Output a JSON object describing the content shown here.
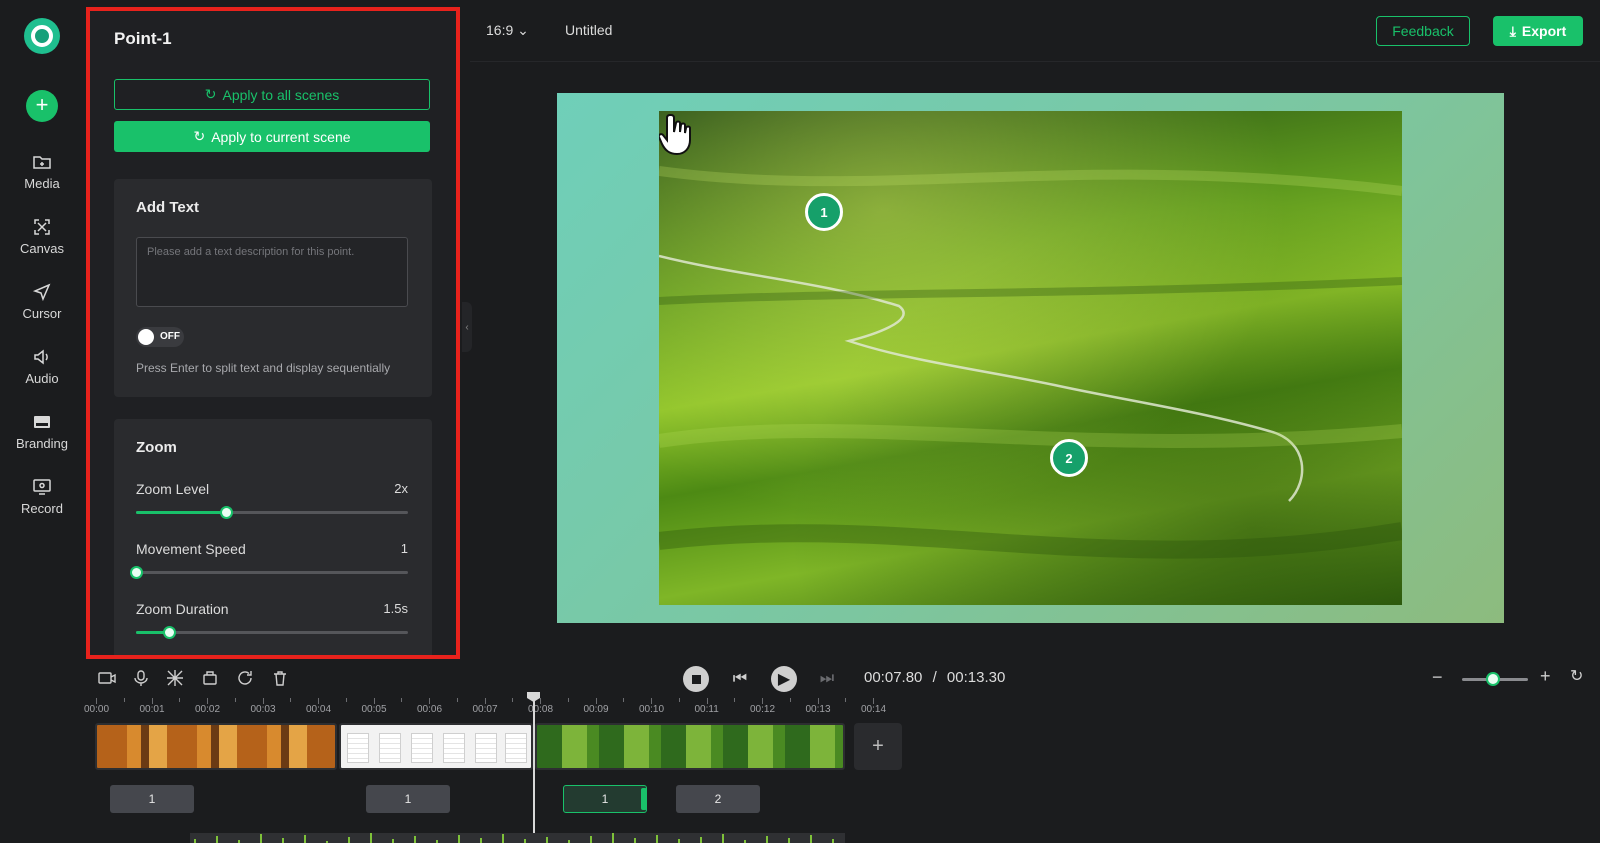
{
  "sidebar": {
    "items": [
      {
        "label": "Media",
        "icon": "folder-icon"
      },
      {
        "label": "Canvas",
        "icon": "canvas-icon"
      },
      {
        "label": "Cursor",
        "icon": "cursor-icon"
      },
      {
        "label": "Audio",
        "icon": "speaker-icon"
      },
      {
        "label": "Branding",
        "icon": "branding-icon"
      },
      {
        "label": "Record",
        "icon": "record-icon"
      }
    ]
  },
  "panel": {
    "title": "Point-1",
    "apply_all_label": "Apply to all scenes",
    "apply_current_label": "Apply to current scene",
    "add_text": {
      "title": "Add Text",
      "placeholder": "Please add a text description for this point.",
      "value": "",
      "toggle_label": "OFF",
      "toggle_on": false,
      "hint": "Press Enter to split text and display sequentially"
    },
    "zoom": {
      "title": "Zoom",
      "sliders": [
        {
          "label": "Zoom Level",
          "value": "2x",
          "fraction": 0.33
        },
        {
          "label": "Movement Speed",
          "value": "1",
          "fraction": 0.0
        },
        {
          "label": "Zoom Duration",
          "value": "1.5s",
          "fraction": 0.12
        }
      ]
    }
  },
  "topbar": {
    "aspect_ratio": "16:9",
    "document_title": "Untitled",
    "feedback_label": "Feedback",
    "export_label": "Export"
  },
  "canvas": {
    "points": [
      "1",
      "2"
    ]
  },
  "timeline": {
    "current_time": "00:07.80",
    "separator": "/",
    "total_time": "00:13.30",
    "ruler_labels": [
      "00:00",
      "00:01",
      "00:02",
      "00:03",
      "00:04",
      "00:05",
      "00:06",
      "00:07",
      "00:08",
      "00:09",
      "00:10",
      "00:11",
      "00:12",
      "00:13",
      "00:14"
    ],
    "markers": [
      "1",
      "1",
      "1",
      "2"
    ],
    "add_clip_label": "+"
  },
  "colors": {
    "accent": "#19c16a",
    "highlight_border": "#e8221c",
    "background": "#1b1c1e",
    "panel_background": "#1f2023"
  }
}
